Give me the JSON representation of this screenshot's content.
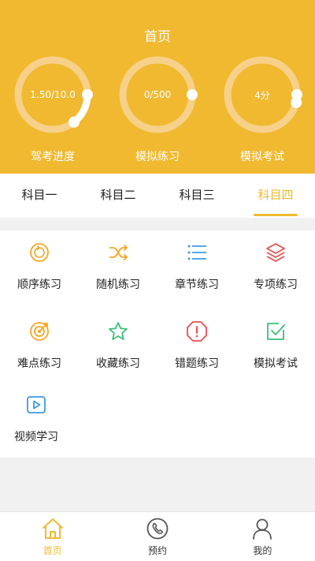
{
  "header": {
    "title": "首页"
  },
  "gauges": [
    {
      "value_text": "1.50/10.0",
      "label": "驾考进度",
      "progress": 0.15
    },
    {
      "value_text": "0/500",
      "label": "模拟练习",
      "progress": 0
    },
    {
      "value_text": "4分",
      "label": "模拟考试",
      "progress": 0.04
    }
  ],
  "subject_tabs": [
    "科目一",
    "科目二",
    "科目三",
    "科目四"
  ],
  "active_tab": "科目四",
  "practice_items": [
    {
      "label": "顺序练习",
      "icon": "sequence-icon"
    },
    {
      "label": "随机练习",
      "icon": "shuffle-icon"
    },
    {
      "label": "章节练习",
      "icon": "list-icon"
    },
    {
      "label": "专项练习",
      "icon": "layers-icon"
    },
    {
      "label": "难点练习",
      "icon": "target-icon"
    },
    {
      "label": "收藏练习",
      "icon": "star-icon"
    },
    {
      "label": "错题练习",
      "icon": "error-icon"
    },
    {
      "label": "模拟考试",
      "icon": "checkbox-icon"
    },
    {
      "label": "视频学习",
      "icon": "video-icon"
    }
  ],
  "bottom_nav": [
    {
      "label": "首页",
      "icon": "home-icon",
      "active": true
    },
    {
      "label": "预约",
      "icon": "phone-icon",
      "active": false
    },
    {
      "label": "我的",
      "icon": "user-icon",
      "active": false
    }
  ],
  "colors": {
    "accent": "#f0b92f",
    "ring_track": "#f7d18a",
    "orange": "#f5a623",
    "blue": "#3a9be8",
    "green": "#3bbf7a",
    "red": "#e94e4e"
  }
}
